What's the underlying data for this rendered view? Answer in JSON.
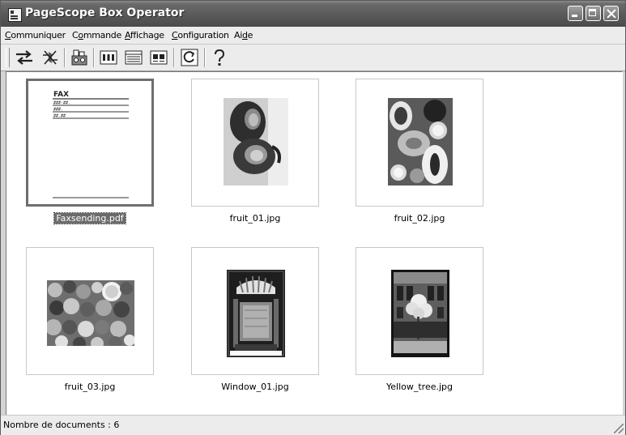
{
  "window": {
    "title": "PageScope Box Operator"
  },
  "menu": [
    {
      "pre": "",
      "ul": "C",
      "post": "ommuniquer"
    },
    {
      "pre": "C",
      "ul": "o",
      "post": "mmande"
    },
    {
      "pre": "",
      "ul": "A",
      "post": "ffichage"
    },
    {
      "pre": "",
      "ul": "C",
      "post": "onfiguration"
    },
    {
      "pre": "Ai",
      "ul": "d",
      "post": "e"
    }
  ],
  "toolbar": {
    "icons": [
      "transfer-icon",
      "disconnect-icon",
      "box-settings-icon",
      "large-icons-view-icon",
      "details-view-icon",
      "thumbnail-view-icon",
      "refresh-icon",
      "help-icon"
    ]
  },
  "documents": [
    {
      "name": "Faxsending.pdf",
      "selected": true,
      "fax": {
        "heading": "FAX",
        "rows": [
          "###·##.",
          "###.",
          "##.##"
        ]
      }
    },
    {
      "name": "fruit_01.jpg",
      "selected": false
    },
    {
      "name": "fruit_02.jpg",
      "selected": false
    },
    {
      "name": "fruit_03.jpg",
      "selected": false
    },
    {
      "name": "Window_01.jpg",
      "selected": false
    },
    {
      "name": "Yellow_tree.jpg",
      "selected": false
    }
  ],
  "status": {
    "text": "Nombre de documents : 6"
  }
}
